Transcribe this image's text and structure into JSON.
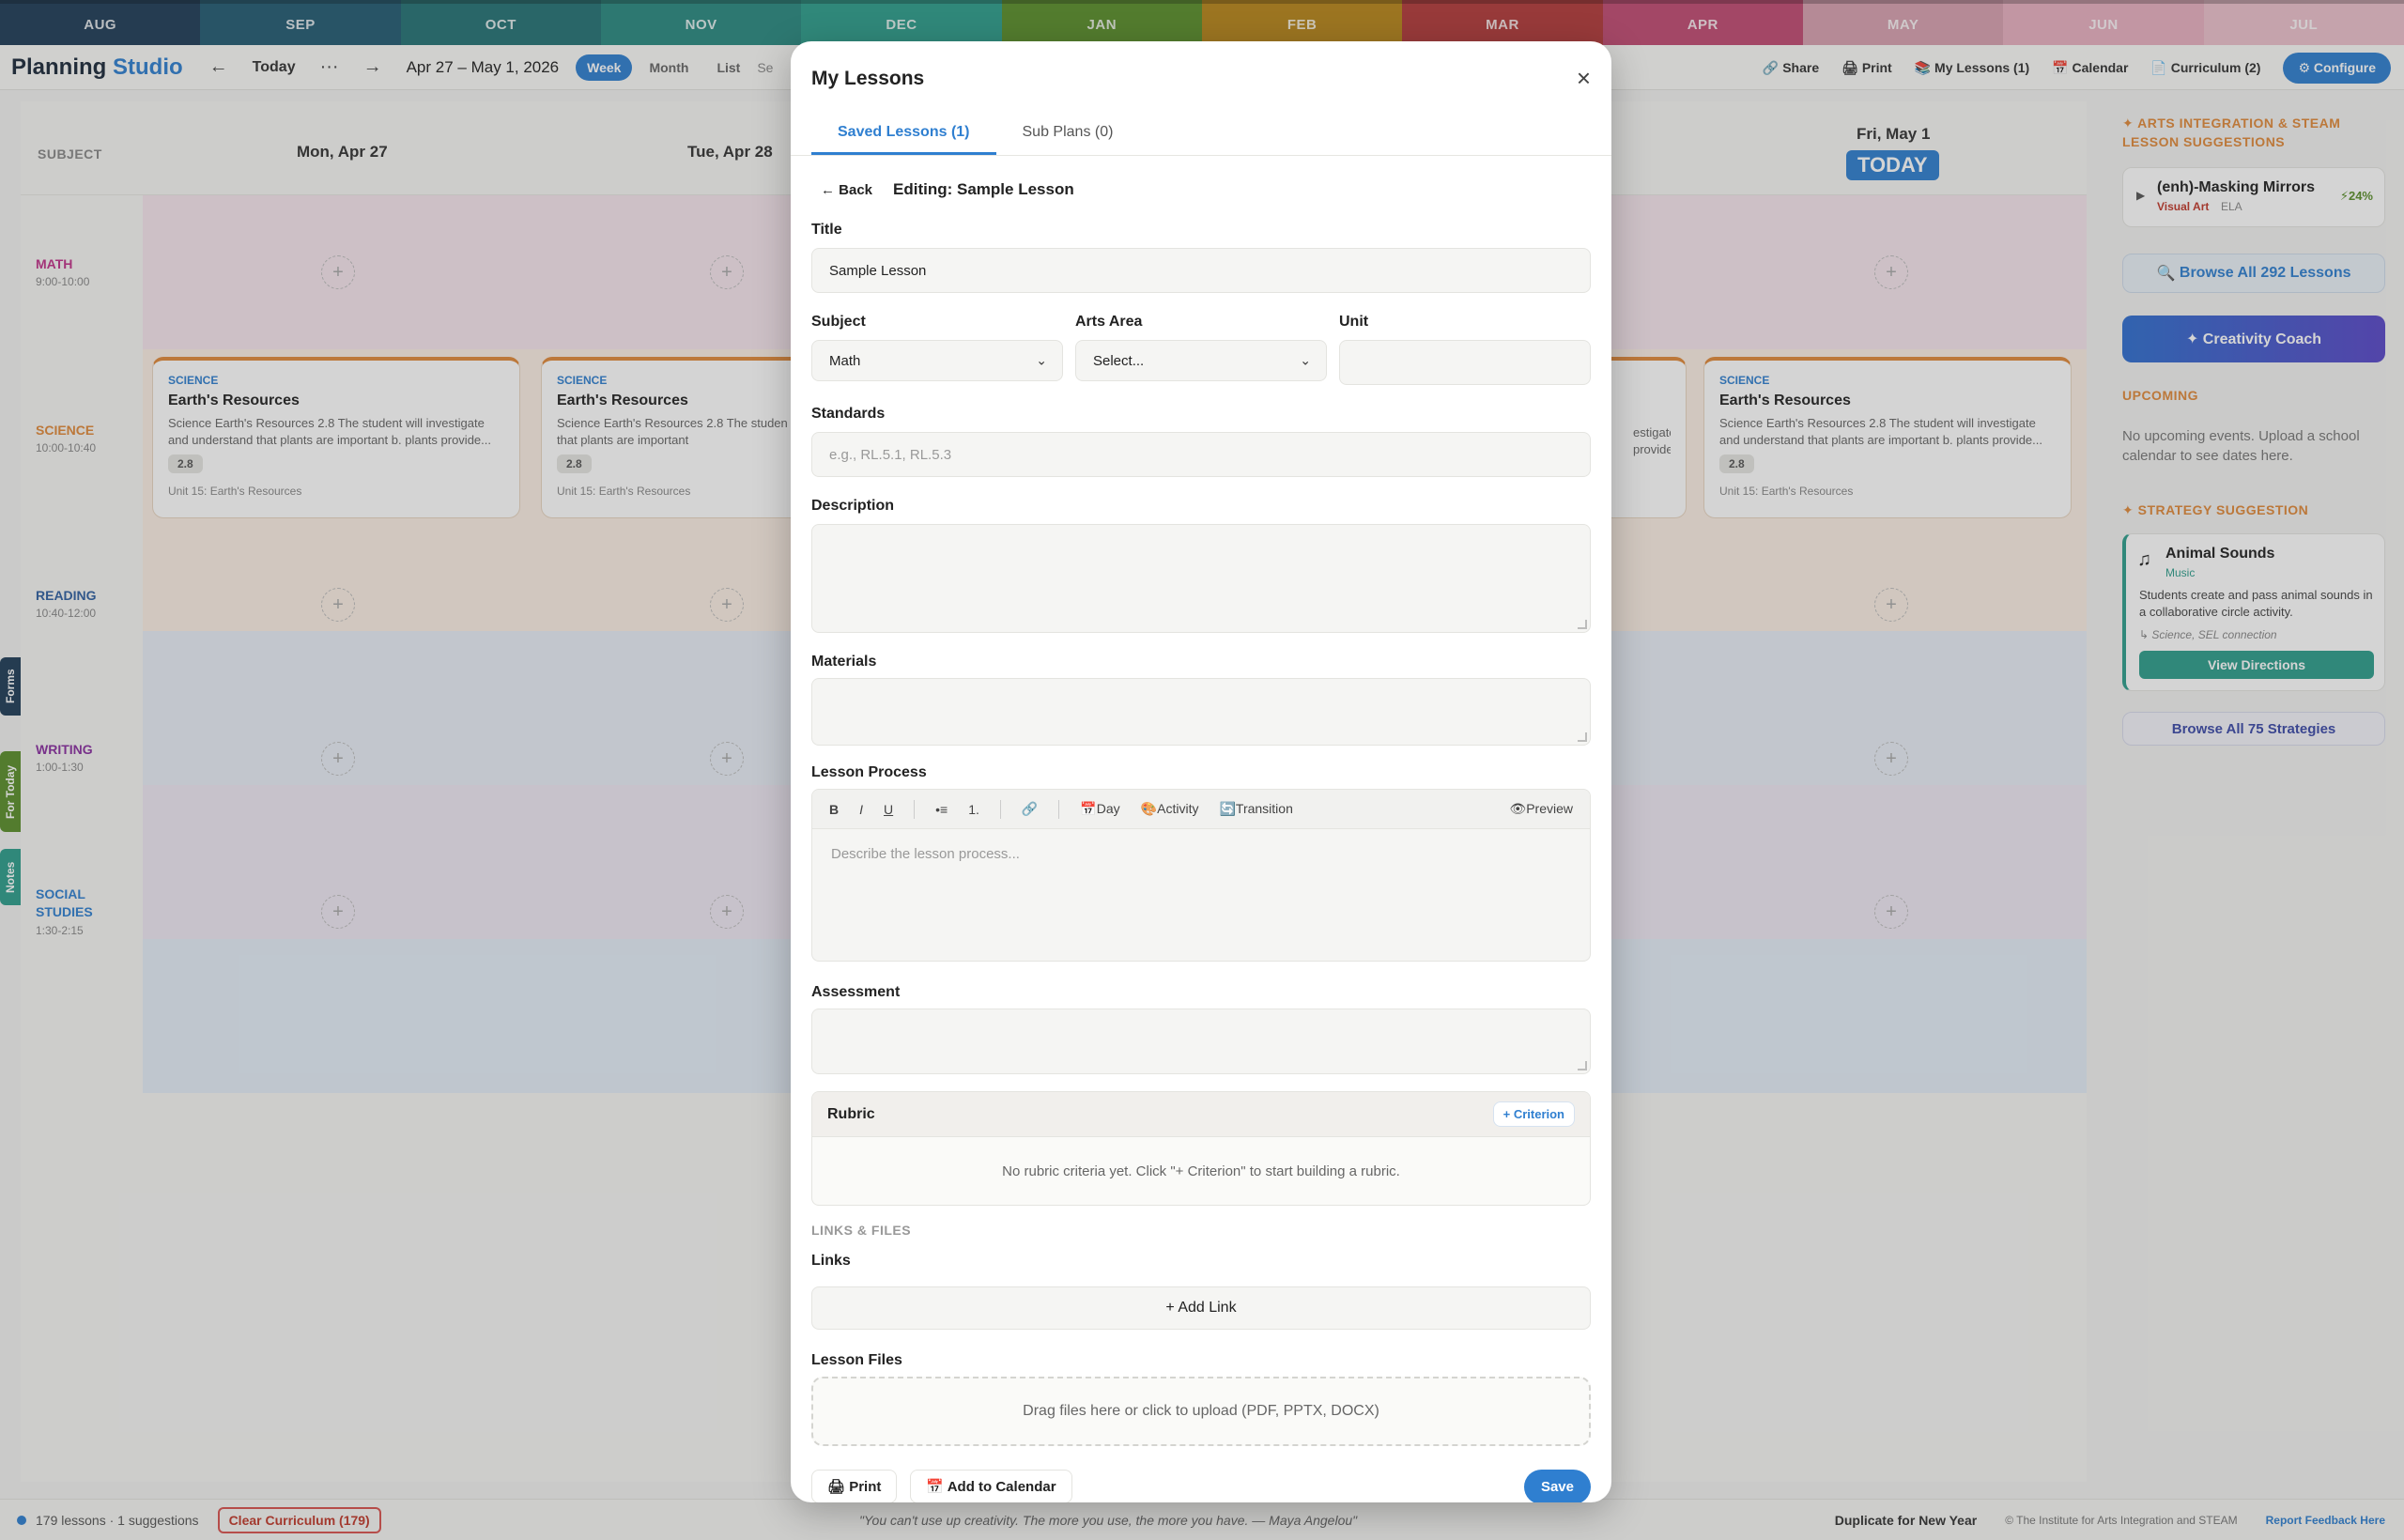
{
  "months": [
    {
      "label": "AUG",
      "color": "#1f3d58"
    },
    {
      "label": "SEP",
      "color": "#235b73"
    },
    {
      "label": "OCT",
      "color": "#257275"
    },
    {
      "label": "NOV",
      "color": "#2a8a80"
    },
    {
      "label": "DEC",
      "color": "#2e9e8c"
    },
    {
      "label": "JAN",
      "color": "#5a8f2b"
    },
    {
      "label": "FEB",
      "color": "#b8861a"
    },
    {
      "label": "MAR",
      "color": "#b33a3a"
    },
    {
      "label": "APR",
      "color": "#c14b72"
    },
    {
      "label": "MAY",
      "color": "#d8a0b0"
    },
    {
      "label": "JUN",
      "color": "#e8b0c0"
    },
    {
      "label": "JUL",
      "color": "#ecc0cc"
    }
  ],
  "nav": {
    "brand_a": "Planning",
    "brand_b": "Studio",
    "prev": "←",
    "today": "Today",
    "more": "···",
    "next": "→",
    "date_range": "Apr 27 – May 1, 2026",
    "views": [
      "Week",
      "Month",
      "List"
    ],
    "search_stub": "Se",
    "share": "Share",
    "print": "Print",
    "my_lessons": "My Lessons (1)",
    "calendar": "Calendar",
    "curriculum": "Curriculum (2)",
    "configure": "Configure"
  },
  "calendar": {
    "subject_header": "SUBJECT",
    "days": [
      "Mon, Apr 27",
      "Tue, Apr 28"
    ],
    "friday": "Fri, May 1",
    "today_badge": "TODAY",
    "rows": [
      {
        "label": "MATH",
        "time": "9:00-10:00",
        "color": "#c0328a",
        "band": "#f6e6ee"
      },
      {
        "label": "SCIENCE",
        "time": "10:00-10:40",
        "color": "#e0893a",
        "band": "#fbefe4"
      },
      {
        "label": "READING",
        "time": "10:40-12:00",
        "color": "#2f5fa0",
        "band": "#e8eef6"
      },
      {
        "label": "WRITING",
        "time": "1:00-1:30",
        "color": "#8a2fa0",
        "band": "#efe8f4"
      },
      {
        "label": "SOCIAL",
        "label2": "STUDIES",
        "time": "1:30-2:15",
        "color": "#2f7fd0",
        "band": "#e4eef8"
      }
    ],
    "lesson": {
      "tag": "SCIENCE",
      "title": "Earth's Resources",
      "desc": "Science Earth's Resources 2.8 The student will investigate and understand that plants are important b. plants provide...",
      "desc_b": "Science Earth's Resources 2.8 The studen and understand that plants are important",
      "desc_d": "estigate provide...",
      "badge": "2.8",
      "unit": "Unit 15: Earth's Resources"
    }
  },
  "sidetabs": [
    "Forms",
    "For Today",
    "Notes"
  ],
  "sidebar": {
    "arts_heading": "✦ ARTS INTEGRATION & STEAM LESSON SUGGESTIONS",
    "suggestion_title": "(enh)-Masking Mirrors",
    "suggestion_area": "Visual Art",
    "suggestion_sub": "ELA",
    "suggestion_pct": "⚡24%",
    "browse_lessons": "Browse All 292 Lessons",
    "creativity_coach": "✦ Creativity Coach",
    "upcoming_heading": "UPCOMING",
    "upcoming_text": "No upcoming events. Upload a school calendar to see dates here.",
    "strategy_heading": "✦ STRATEGY SUGGESTION",
    "strategy_title": "Animal Sounds",
    "strategy_area": "Music",
    "strategy_desc": "Students create and pass animal sounds in a collaborative circle activity.",
    "strategy_tags": "↳ Science, SEL connection",
    "view_directions": "View Directions",
    "browse_strategies": "Browse All 75 Strategies"
  },
  "footer": {
    "count": "179 lessons · 1 suggestions",
    "clear": "Clear Curriculum (179)",
    "quote": "\"You can't use up creativity. The more you use, the more you have. — Maya Angelou\"",
    "duplicate": "Duplicate for New Year",
    "copyright": "© The Institute for Arts Integration and STEAM",
    "feedback": "Report Feedback Here"
  },
  "modal": {
    "title": "My Lessons",
    "close": "×",
    "tab_saved": "Saved Lessons (1)",
    "tab_sub": "Sub Plans (0)",
    "back": "← Back",
    "editing": "Editing: Sample Lesson",
    "title_label": "Title",
    "title_value": "Sample Lesson",
    "subject_label": "Subject",
    "subject_value": "Math",
    "arts_label": "Arts Area",
    "arts_value": "Select...",
    "unit_label": "Unit",
    "standards_label": "Standards",
    "standards_placeholder": "e.g., RL.5.1, RL.5.3",
    "description_label": "Description",
    "materials_label": "Materials",
    "process_label": "Lesson Process",
    "toolbar": {
      "bold": "B",
      "italic": "I",
      "underline": "U",
      "bullets": "•≡",
      "numbered": "1.",
      "link": "🔗",
      "day": "Day",
      "activity": "Activity",
      "transition": "Transition",
      "preview": "Preview"
    },
    "process_placeholder": "Describe the lesson process...",
    "assessment_label": "Assessment",
    "rubric_title": "Rubric",
    "criterion_btn": "+ Criterion",
    "rubric_empty": "No rubric criteria yet. Click \"+ Criterion\" to start building a rubric.",
    "links_files_cap": "LINKS & FILES",
    "links_label": "Links",
    "add_link": "+ Add Link",
    "files_label": "Lesson Files",
    "dropzone": "Drag files here or click to upload (PDF, PPTX, DOCX)",
    "print": "Print",
    "add_calendar": "Add to Calendar",
    "save": "Save"
  }
}
